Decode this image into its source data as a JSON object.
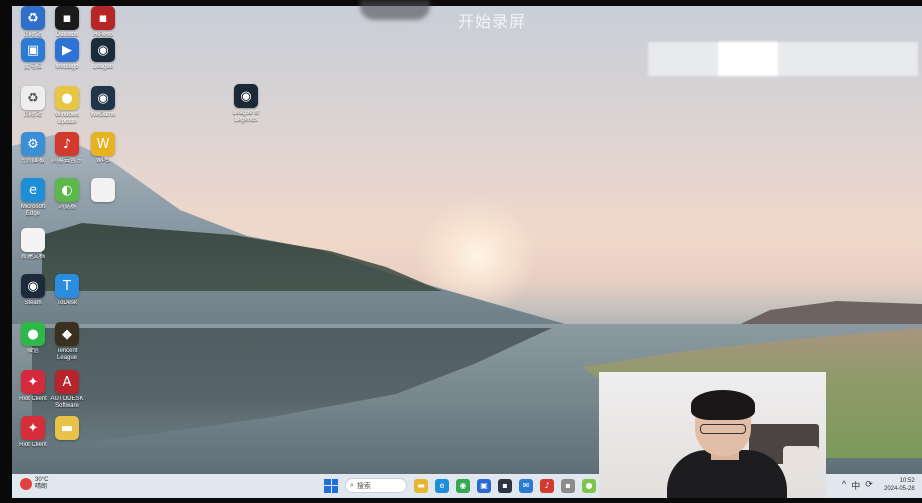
{
  "top_bar": {
    "title": "开始录屏"
  },
  "desktop_icons": [
    {
      "name": "recycle-bin",
      "label": "回收站",
      "color": "#2f6fc9",
      "glyph": "♻"
    },
    {
      "name": "app-1",
      "label": "Daloads\nSystem",
      "color": "#1b1b1b",
      "glyph": "▪"
    },
    {
      "name": "app-2",
      "label": "HiReso\nEditor",
      "color": "#b72626",
      "glyph": "▪"
    },
    {
      "name": "this-pc",
      "label": "此电脑",
      "color": "#2b7bd3",
      "glyph": "▣"
    },
    {
      "name": "mediago",
      "label": "Mediago",
      "color": "#2f72d6",
      "glyph": "▶"
    },
    {
      "name": "league",
      "label": "League",
      "color": "#1a2b3a",
      "glyph": "◉"
    },
    {
      "name": "recycle",
      "label": "回收站",
      "color": "#eeeeee",
      "glyph": "♻"
    },
    {
      "name": "windows-update",
      "label": "Windows\nUpdate",
      "color": "#e7c641",
      "glyph": "●"
    },
    {
      "name": "wegame",
      "label": "WeGame",
      "color": "#20344a",
      "glyph": "◉"
    },
    {
      "name": "control",
      "label": "控制面板",
      "color": "#3b8fd6",
      "glyph": "⚙"
    },
    {
      "name": "netease",
      "label": "网易云音乐",
      "color": "#d23a2e",
      "glyph": "♪"
    },
    {
      "name": "wps",
      "label": "WPS",
      "color": "#e7b321",
      "glyph": "W"
    },
    {
      "name": "edge",
      "label": "Microsoft\nEdge",
      "color": "#1e8ed8",
      "glyph": "e"
    },
    {
      "name": "browser-2",
      "label": "浏览器",
      "color": "#5cb84a",
      "glyph": "◐"
    },
    {
      "name": "blank-doc",
      "label": "",
      "color": "#f2f2f2",
      "glyph": ""
    },
    {
      "name": "doc-file",
      "label": "新建文档",
      "color": "#f4f4f4",
      "glyph": ""
    },
    {
      "name": "steam",
      "label": "Steam",
      "color": "#1d2a3a",
      "glyph": "◉"
    },
    {
      "name": "todesk",
      "label": "ToDesk",
      "color": "#2a8de0",
      "glyph": "T"
    },
    {
      "name": "wechat",
      "label": "微信",
      "color": "#2eb84a",
      "glyph": "●"
    },
    {
      "name": "tencent",
      "label": "Tencent\nLeague",
      "color": "#3a3020",
      "glyph": "◆"
    },
    {
      "name": "app-red",
      "label": "Riot Client",
      "color": "#d42a3c",
      "glyph": "✦"
    },
    {
      "name": "app-red-2",
      "label": "AUTODESK\nSoftware",
      "color": "#b8242c",
      "glyph": "A"
    },
    {
      "name": "riot",
      "label": "Riot Client",
      "color": "#d62d3b",
      "glyph": "✦"
    },
    {
      "name": "folder",
      "label": "",
      "color": "#e9c24a",
      "glyph": "▬"
    },
    {
      "name": "league-floating",
      "label": "League of\nLegends",
      "color": "#1b2a36",
      "glyph": "◉"
    }
  ],
  "taskbar": {
    "weather": "30°C\n晴朗",
    "search_placeholder": "搜索",
    "apps": [
      {
        "name": "start",
        "color": "#1f6fd6",
        "glyph": ""
      },
      {
        "name": "file-explorer",
        "color": "#e6b531",
        "glyph": "▬"
      },
      {
        "name": "edge",
        "color": "#1e8ed8",
        "glyph": "e"
      },
      {
        "name": "chrome",
        "color": "#34a853",
        "glyph": "◉"
      },
      {
        "name": "store",
        "color": "#2d6bd2",
        "glyph": "▣"
      },
      {
        "name": "app-dark",
        "color": "#2b3440",
        "glyph": "▪"
      },
      {
        "name": "mail",
        "color": "#2b7bd3",
        "glyph": "✉"
      },
      {
        "name": "netease",
        "color": "#d23a2e",
        "glyph": "♪"
      },
      {
        "name": "app-gray",
        "color": "#8c8c8c",
        "glyph": "▪"
      },
      {
        "name": "app-green",
        "color": "#7bc64b",
        "glyph": "●"
      }
    ],
    "tray": [
      "^",
      "中",
      "⟳"
    ],
    "clock_time": "10:52",
    "clock_date": "2024-05-28"
  }
}
